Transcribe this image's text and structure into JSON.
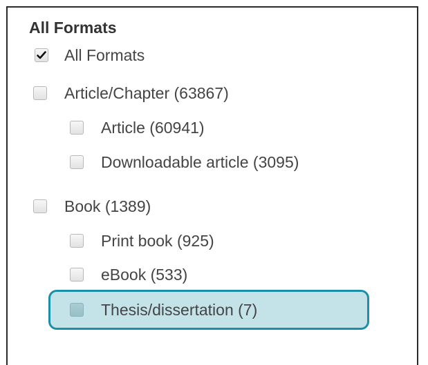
{
  "filter_panel": {
    "heading": "All Formats",
    "items": [
      {
        "label": "All Formats",
        "checked": true
      },
      {
        "label": "Article/Chapter (63867)",
        "checked": false
      },
      {
        "label": "Article (60941)",
        "checked": false
      },
      {
        "label": "Downloadable article (3095)",
        "checked": false
      },
      {
        "label": "Book (1389)",
        "checked": false
      },
      {
        "label": "Print book (925)",
        "checked": false
      },
      {
        "label": "eBook (533)",
        "checked": false
      },
      {
        "label": "Thesis/dissertation (7)",
        "checked": false,
        "highlighted": true
      }
    ]
  },
  "colors": {
    "highlight_border": "#1b8fa8",
    "highlight_fill": "#c4e3e9",
    "text": "#444444"
  }
}
